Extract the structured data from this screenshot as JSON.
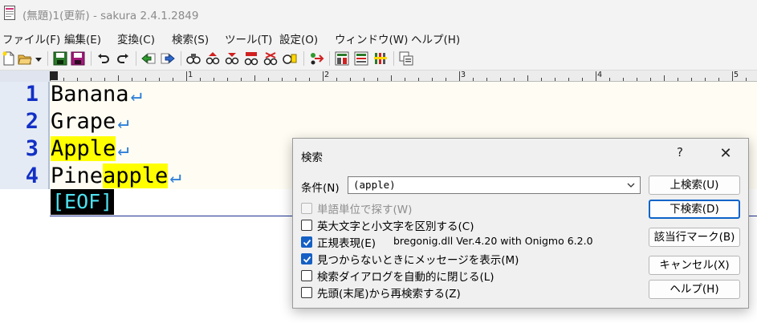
{
  "window": {
    "title": "(無題)1(更新) - sakura 2.4.1.2849"
  },
  "menu": [
    {
      "label": "ファイル(F)"
    },
    {
      "label": "編集(E)"
    },
    {
      "label": "変換(C)"
    },
    {
      "label": "検索(S)"
    },
    {
      "label": "ツール(T)"
    },
    {
      "label": "設定(O)"
    },
    {
      "label": "ウィンドウ(W)"
    },
    {
      "label": "ヘルプ(H)"
    }
  ],
  "toolbar": {
    "buttons": [
      "new-file-icon",
      "open-file-icon",
      "dropdown-icon",
      "save-icon",
      "save-all-icon",
      "undo-icon",
      "redo-icon",
      "jump-back-icon",
      "jump-forward-icon",
      "find-icon",
      "find-prev-icon",
      "find-next-icon",
      "replace-icon",
      "clear-highlight-icon",
      "grep-icon",
      "tag-jump-icon",
      "outline-icon",
      "function-list-icon",
      "settings-icon",
      "window-list-icon"
    ]
  },
  "ruler": {
    "numbers": [
      "1",
      "2",
      "3",
      "4",
      "5"
    ]
  },
  "editor": {
    "lines": [
      {
        "number": "1",
        "before": "Banana",
        "match": "",
        "after": ""
      },
      {
        "number": "2",
        "before": "Grape",
        "match": "",
        "after": ""
      },
      {
        "number": "3",
        "before": "",
        "match": "Apple",
        "after": ""
      },
      {
        "number": "4",
        "before": "Pine",
        "match": "apple",
        "after": ""
      }
    ],
    "line_end": "↵",
    "eof": "[EOF]",
    "highlight_color": "#ffff00",
    "line_number_color": "#1230c6"
  },
  "dialog": {
    "title": "検索",
    "help": "?",
    "close": "✕",
    "condition_label": "条件(N)",
    "condition_value": "(apple)",
    "options": [
      {
        "label": "単語単位で探す(W)",
        "checked": false,
        "disabled": true
      },
      {
        "label": "英大文字と小文字を区別する(C)",
        "checked": false,
        "disabled": false
      },
      {
        "label": "正規表現(E)",
        "checked": true,
        "disabled": false
      },
      {
        "label": "見つからないときにメッセージを表示(M)",
        "checked": true,
        "disabled": false
      },
      {
        "label": "検索ダイアログを自動的に閉じる(L)",
        "checked": false,
        "disabled": false
      },
      {
        "label": "先頭(末尾)から再検索する(Z)",
        "checked": false,
        "disabled": false
      }
    ],
    "regex_library": "bregonig.dll Ver.4.20 with Onigmo 6.2.0",
    "buttons": {
      "search_up": "上検索(U)",
      "search_down": "下検索(D)",
      "mark_lines": "該当行マーク(B)",
      "cancel": "キャンセル(X)",
      "help": "ヘルプ(H)"
    },
    "accent_color": "#1460c4"
  }
}
